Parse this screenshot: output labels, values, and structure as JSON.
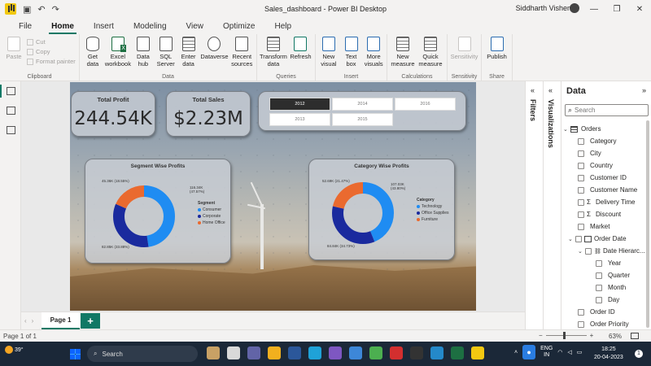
{
  "titlebar": {
    "title": "Sales_dashboard - Power BI Desktop",
    "user": "Siddharth Vishen"
  },
  "menu": [
    "File",
    "Home",
    "Insert",
    "Modeling",
    "View",
    "Optimize",
    "Help"
  ],
  "menu_active": "Home",
  "ribbon": {
    "clipboard": {
      "label": "Clipboard",
      "paste": "Paste",
      "cut": "Cut",
      "copy": "Copy",
      "format_painter": "Format painter"
    },
    "data": {
      "label": "Data",
      "get_data": "Get data",
      "excel": "Excel workbook",
      "data_hub": "Data hub",
      "sql": "SQL Server",
      "enter": "Enter data",
      "dataverse": "Dataverse",
      "recent": "Recent sources"
    },
    "queries": {
      "label": "Queries",
      "transform": "Transform data",
      "refresh": "Refresh"
    },
    "insert": {
      "label": "Insert",
      "new_visual": "New visual",
      "text_box": "Text box",
      "more_visuals": "More visuals"
    },
    "calculations": {
      "label": "Calculations",
      "new_measure": "New measure",
      "quick_measure": "Quick measure"
    },
    "sensitivity": {
      "label": "Sensitivity",
      "sensitivity": "Sensitivity"
    },
    "share": {
      "label": "Share",
      "publish": "Publish"
    }
  },
  "report": {
    "kpis": [
      {
        "label": "Total Profit",
        "value": "244.54K"
      },
      {
        "label": "Total Sales",
        "value": "$2.23M"
      }
    ],
    "years": [
      "2012",
      "2014",
      "2016",
      "2013",
      "2015"
    ],
    "selected_year": "2012"
  },
  "chart_data": [
    {
      "type": "pie",
      "title": "Segment Wise Profits",
      "legend_title": "Segment",
      "categories": [
        "Consumer",
        "Corporate",
        "Home Office"
      ],
      "values": [
        116.34,
        82.85,
        45.36
      ],
      "data_labels": [
        "116.34K (47.57%)",
        "82.85K (33.88%)",
        "45.36K (18.55%)"
      ],
      "colors": [
        "#1f8cf2",
        "#1a2a9e",
        "#ea6a2f"
      ],
      "legend_position": "right"
    },
    {
      "type": "pie",
      "title": "Category Wise Profits",
      "legend_title": "Category",
      "categories": [
        "Technology",
        "Office Supplies",
        "Furniture"
      ],
      "values": [
        107.03,
        84.84,
        52.69
      ],
      "data_labels": [
        "107.03K (43.80%)",
        "84.84K (34.73%)",
        "52.69K (21.47%)"
      ],
      "colors": [
        "#1f8cf2",
        "#1a2a9e",
        "#ea6a2f"
      ],
      "legend_position": "right"
    }
  ],
  "panes": {
    "filters": "Filters",
    "visualizations": "Visualizations",
    "data_title": "Data",
    "search_placeholder": "Search",
    "table": "Orders",
    "fields": [
      {
        "name": "Category",
        "kind": "field"
      },
      {
        "name": "City",
        "kind": "field"
      },
      {
        "name": "Country",
        "kind": "field"
      },
      {
        "name": "Customer ID",
        "kind": "field"
      },
      {
        "name": "Customer Name",
        "kind": "field"
      },
      {
        "name": "Delivery Time",
        "kind": "sum"
      },
      {
        "name": "Discount",
        "kind": "sum"
      },
      {
        "name": "Market",
        "kind": "field"
      }
    ],
    "order_date": "Order Date",
    "date_hierarchy": "Date Hierarc...",
    "date_levels": [
      "Year",
      "Quarter",
      "Month",
      "Day"
    ],
    "fields_after": [
      "Order ID",
      "Order Priority"
    ]
  },
  "page_tabs": {
    "page1": "Page 1",
    "add": "+"
  },
  "status": {
    "page": "Page 1 of 1",
    "zoom": "63%"
  },
  "taskbar": {
    "temp": "39°",
    "search": "Search",
    "lang1": "ENG",
    "lang2": "IN",
    "time": "18:25",
    "date": "20-04-2023",
    "notif": "1"
  }
}
